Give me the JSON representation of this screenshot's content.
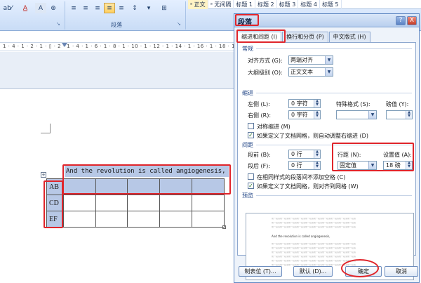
{
  "ribbon": {
    "font_buttons": [
      "ab⁄",
      "A",
      "A",
      "⊕"
    ],
    "para_buttons": [
      "≡",
      "≡",
      "≡",
      "≡",
      "≡",
      "↕",
      "▾",
      "⊞"
    ],
    "group_label": "段落",
    "styles": [
      "ᵃ 正文",
      "ᵃ 无间隔",
      "标题 1",
      "标题 2",
      "标题 3",
      "标题 4",
      "标题 5"
    ]
  },
  "ruler": {
    "text": "1 · 4 · 1 · 2 · 1 · ▯ · 2 · 1 · 4 · 1 · 6 · 1 · 8 · 1 · 10 · 1 · 12 · 1 · 14 · 1 · 16 · 1 · 18 · 1 · 20"
  },
  "document": {
    "line_text": "And the revolution is called angiogenesis,",
    "table_handle": "+",
    "rows": [
      "AB",
      "CD",
      "EF"
    ]
  },
  "dialog": {
    "title": "段落",
    "help": "?",
    "close": "X",
    "tabs": [
      "缩进和间距 (I)",
      "换行和分页 (P)",
      "中文版式 (H)"
    ],
    "general": {
      "heading": "常规",
      "align_label": "对齐方式 (G):",
      "align_value": "两端对齐",
      "outline_label": "大纲级别 (O):",
      "outline_value": "正文文本"
    },
    "indent": {
      "heading": "缩进",
      "left_label": "左侧 (L):",
      "left_value": "0 字符",
      "right_label": "右侧 (R):",
      "right_value": "0 字符",
      "special_label": "特殊格式 (S):",
      "special_value": "",
      "by_label": "磅值 (Y):",
      "by_value": "",
      "mirror_label": "对称缩进 (M)",
      "grid_label": "如果定义了文档网格，则自动调整右缩进 (D)"
    },
    "spacing": {
      "heading": "间距",
      "before_label": "段前 (B):",
      "before_value": "0 行",
      "after_label": "段后 (F):",
      "after_value": "0 行",
      "line_label": "行距 (N):",
      "line_value": "固定值",
      "at_label": "设置值 (A):",
      "at_value": "18 磅",
      "no_space_label": "在相同样式的段落间不添加空格 (C)",
      "snap_label": "如果定义了文档网格，则对齐到网格 (W)"
    },
    "preview": {
      "heading": "预览",
      "line": "前一段落前一段落前一段落前一段落前一段落前一段落前一段落前一段落前一段落前一段落",
      "sample": "And the revolution is called angiogenesis,"
    },
    "buttons": {
      "tabs": "制表位 (T)...",
      "default": "默认 (D)...",
      "ok": "确定",
      "cancel": "取消"
    }
  },
  "colors": {
    "highlight": "#e0252b",
    "selection": "#b7c8e6",
    "dialog_border": "#5e86c2"
  }
}
